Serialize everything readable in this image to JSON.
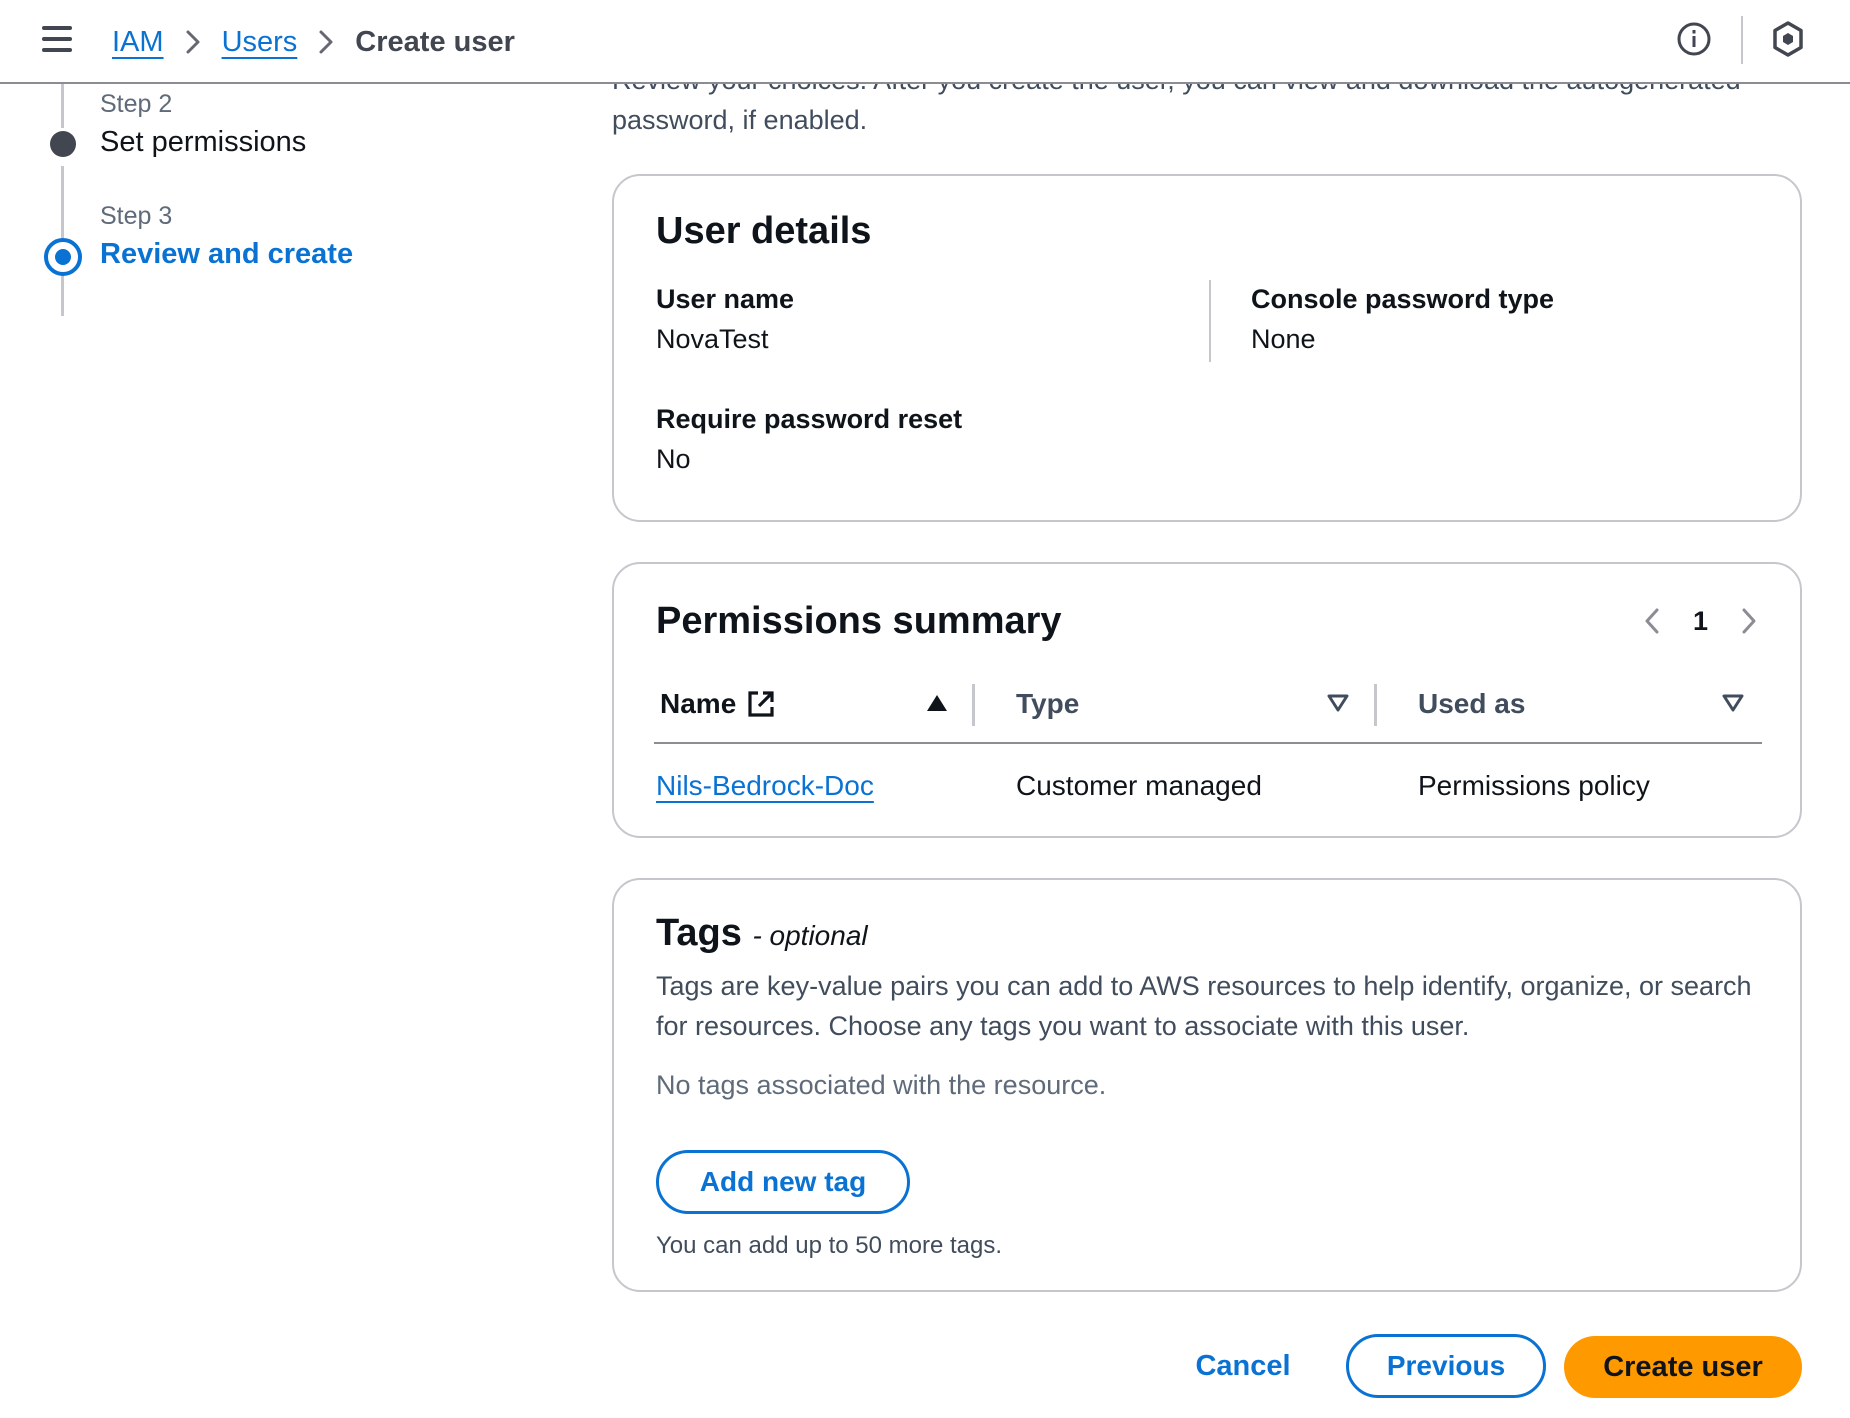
{
  "breadcrumb": {
    "items": [
      {
        "label": "IAM"
      },
      {
        "label": "Users"
      },
      {
        "label": "Create user"
      }
    ]
  },
  "steps": [
    {
      "step_label": "Step 2",
      "title": "Set permissions",
      "state": "completed"
    },
    {
      "step_label": "Step 3",
      "title": "Review and create",
      "state": "active"
    }
  ],
  "intro": {
    "text": "Review your choices. After you create the user, you can view and download the autogenerated password, if enabled."
  },
  "user_details": {
    "title": "User details",
    "user_name_label": "User name",
    "user_name_value": "NovaTest",
    "console_password_type_label": "Console password type",
    "console_password_type_value": "None",
    "require_password_reset_label": "Require password reset",
    "require_password_reset_value": "No"
  },
  "permissions_summary": {
    "title": "Permissions summary",
    "page": "1",
    "columns": [
      "Name",
      "Type",
      "Used as"
    ],
    "rows": [
      {
        "name": "Nils-Bedrock-Doc",
        "type": "Customer managed",
        "used_as": "Permissions policy"
      }
    ]
  },
  "tags": {
    "title": "Tags",
    "optional": "- optional",
    "description": "Tags are key-value pairs you can add to AWS resources to help identify, organize, or search for resources. Choose any tags you want to associate with this user.",
    "empty_text": "No tags associated with the resource.",
    "add_button": "Add new tag",
    "hint": "You can add up to 50 more tags."
  },
  "footer": {
    "cancel": "Cancel",
    "previous": "Previous",
    "create": "Create user"
  },
  "colors": {
    "link_blue": "#0972d3",
    "primary_orange": "#ff9900",
    "border_gray": "#c6c6cd"
  },
  "icons": [
    "menu-icon",
    "chevron-right-icon",
    "info-icon",
    "hexagon-settings-icon",
    "external-link-icon",
    "sort-ascending-icon",
    "sort-descending-icon",
    "chevron-left-icon"
  ]
}
